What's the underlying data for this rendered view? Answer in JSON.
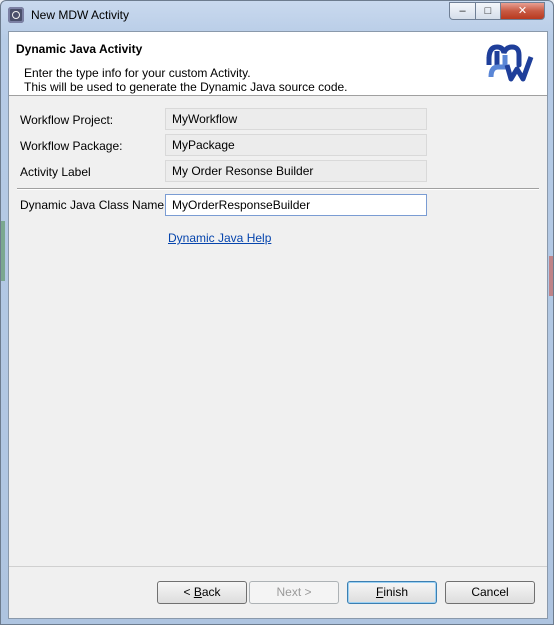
{
  "window": {
    "title": "New MDW Activity",
    "controls": {
      "minimize": "–",
      "maximize": "□",
      "close": "✕"
    }
  },
  "banner": {
    "title": "Dynamic Java Activity",
    "description_line1": "Enter the type info for your custom Activity.",
    "description_line2": "This will be used to generate the Dynamic Java source code.",
    "logo_icon": "mdw-logo-icon"
  },
  "fields": [
    {
      "label": "Workflow Project:",
      "value": "MyWorkflow"
    },
    {
      "label": "Workflow Package:",
      "value": "MyPackage"
    },
    {
      "label": "Activity Label",
      "value": "My Order Resonse Builder"
    }
  ],
  "class_name": {
    "label": "Dynamic Java Class Name:",
    "value": "MyOrderResponseBuilder"
  },
  "help_link": "Dynamic Java Help",
  "buttons": {
    "back_prefix": "< ",
    "back_mnemonic": "B",
    "back_rest": "ack",
    "next": "Next >",
    "finish_mnemonic": "F",
    "finish_rest": "inish",
    "cancel": "Cancel"
  },
  "colors": {
    "link": "#0645ad",
    "banner_bg": "#ffffff",
    "dialog_bg": "#f0f0f0"
  }
}
